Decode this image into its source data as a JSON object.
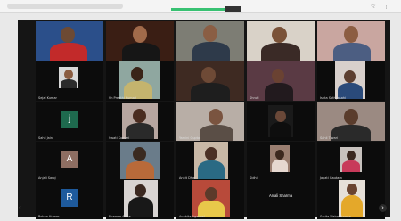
{
  "browser": {
    "icons": "☆ ⋮"
  },
  "tile_names": [
    "",
    "",
    "",
    "",
    "",
    "Sejal Kumar",
    "Sh Preethi Kumari",
    "",
    "Shruti",
    "Ishta Sathyasahi",
    "Sahil Jain",
    "Swati Kumari",
    "Yamini Gupta",
    "",
    "Sahil Tiwari",
    "Anjali Saroj",
    "",
    "Ankit Dhar",
    "Sidhi",
    "Jayati Gautam",
    "Rohan Kumar",
    "Bhawna Arora",
    "Anahita Agarwal",
    "",
    "Sarita Vishwakarma"
  ],
  "avatars": {
    "j": "j",
    "a": "A",
    "r": "R"
  },
  "center_label": "Anjali Sharma",
  "nav": {
    "left": "‹",
    "right": "›"
  }
}
